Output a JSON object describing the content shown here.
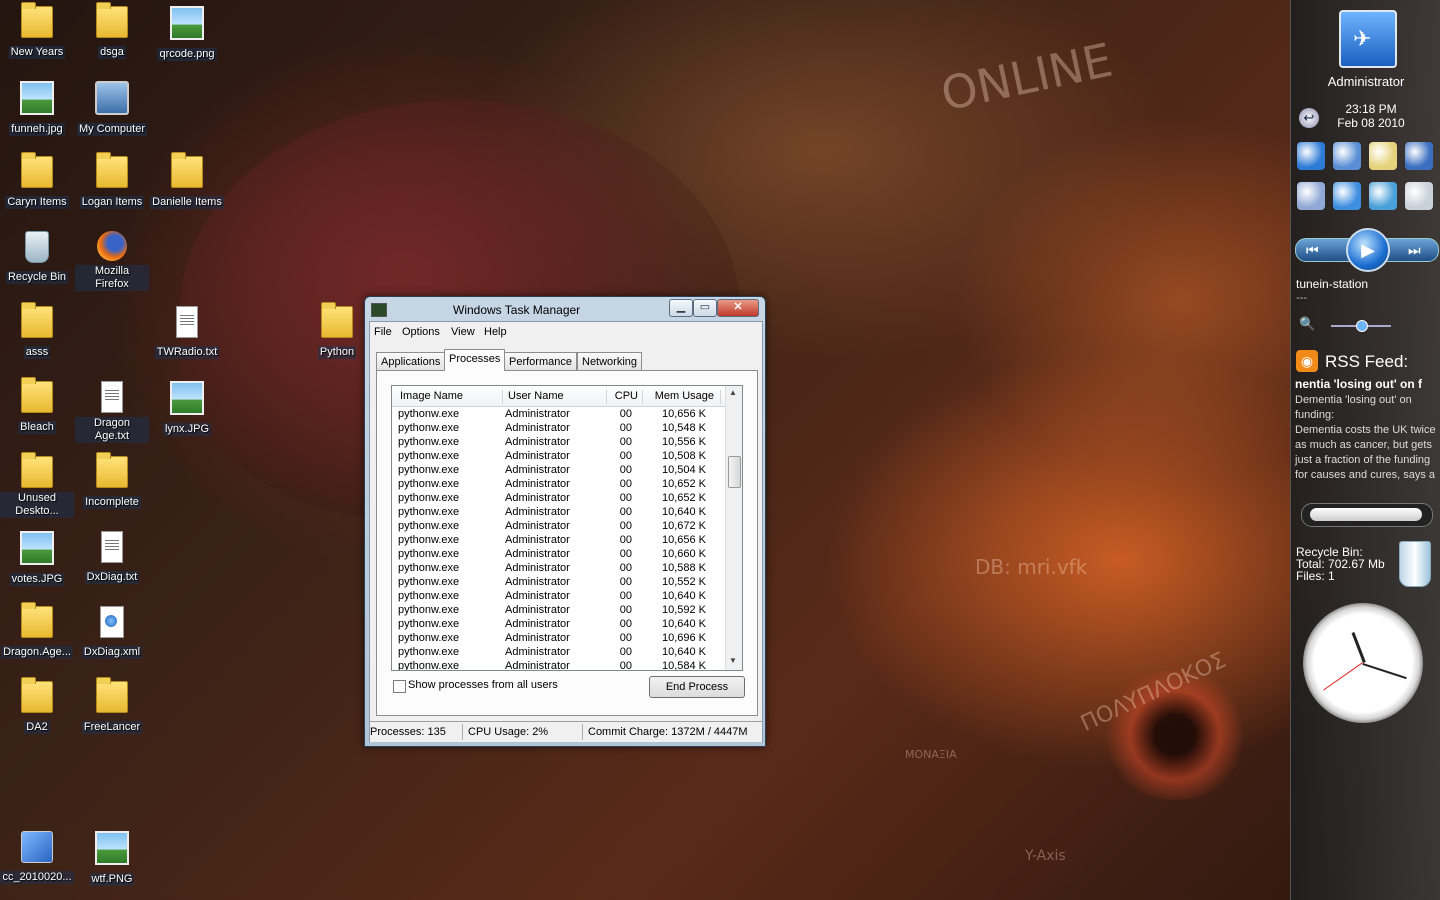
{
  "desktop": {
    "icons": [
      {
        "label": "New Years",
        "icon": "folder-icon",
        "type": "folder"
      },
      {
        "label": "dsga",
        "icon": "folder-icon",
        "type": "folder"
      },
      {
        "label": "qrcode.png",
        "icon": "image-file-icon",
        "type": "img"
      },
      {
        "label": "funneh.jpg",
        "icon": "image-file-icon",
        "type": "img"
      },
      {
        "label": "My Computer",
        "icon": "computer-icon",
        "type": "comp"
      },
      {
        "label": "Caryn Items",
        "icon": "folder-icon",
        "type": "folder"
      },
      {
        "label": "Logan Items",
        "icon": "folder-icon",
        "type": "folder"
      },
      {
        "label": "Danielle Items",
        "icon": "folder-icon",
        "type": "folder"
      },
      {
        "label": "Recycle Bin",
        "icon": "recycle-bin-icon",
        "type": "bin"
      },
      {
        "label": "Mozilla Firefox",
        "icon": "firefox-icon",
        "type": "fox"
      },
      {
        "label": "asss",
        "icon": "folder-icon",
        "type": "folder"
      },
      {
        "label": "TWRadio.txt",
        "icon": "text-file-icon",
        "type": "txt"
      },
      {
        "label": "Python",
        "icon": "folder-icon",
        "type": "folder"
      },
      {
        "label": "Bleach",
        "icon": "folder-icon",
        "type": "folder"
      },
      {
        "label": "Dragon Age.txt",
        "icon": "text-file-icon",
        "type": "txt"
      },
      {
        "label": "lynx.JPG",
        "icon": "image-file-icon",
        "type": "img"
      },
      {
        "label": "Unused Deskto...",
        "icon": "folder-icon",
        "type": "folder"
      },
      {
        "label": "Incomplete",
        "icon": "folder-icon",
        "type": "folder"
      },
      {
        "label": "votes.JPG",
        "icon": "image-file-icon",
        "type": "img"
      },
      {
        "label": "DxDiag.txt",
        "icon": "text-file-icon",
        "type": "txt"
      },
      {
        "label": "Dragon.Age...",
        "icon": "folder-icon",
        "type": "folder"
      },
      {
        "label": "DxDiag.xml",
        "icon": "xml-file-icon",
        "type": "xml"
      },
      {
        "label": "DA2",
        "icon": "folder-icon",
        "type": "folder"
      },
      {
        "label": "FreeLancer",
        "icon": "folder-icon",
        "type": "folder"
      },
      {
        "label": "cc_2010020...",
        "icon": "registry-file-icon",
        "type": "cc"
      },
      {
        "label": "wtf.PNG",
        "icon": "image-file-icon",
        "type": "img"
      }
    ],
    "wallpaper_text": [
      "ONLINE",
      "DB: mri.vfk",
      "Y-Axis",
      "MONAΞIA",
      "ΠΟΛΥΠΛΟΚΟΣ"
    ]
  },
  "sidebar": {
    "user_name": "Administrator",
    "time": "23:18 PM",
    "date": "Feb 08 2010",
    "quick_icons": [
      "globe-icon",
      "computer-icon",
      "document-icon",
      "network-icon",
      "mail-icon",
      "window-icon",
      "users-icon",
      "search-icon"
    ],
    "media": {
      "station": "tunein-station",
      "track": "---",
      "prev_icon": "previous-icon",
      "play_icon": "play-icon",
      "next_icon": "next-icon",
      "volume_level": 0.5
    },
    "rss": {
      "title": "RSS Feed:",
      "headline": "nentia 'losing out' on f",
      "body": "Dementia 'losing out' on funding:\nDementia costs the UK twice as much as cancer, but gets just a fraction of the funding for causes and cures, says a"
    },
    "recycle_bin": {
      "label": "Recycle Bin:",
      "total": "Total: 702.67 Mb",
      "files": "Files: 1"
    },
    "clock": {
      "hour": 23,
      "minute": 18
    }
  },
  "task_manager": {
    "title": "Windows Task Manager",
    "buttons": {
      "minimize": "▁",
      "maximize": "▭",
      "close": "✕"
    },
    "menu": [
      "File",
      "Options",
      "View",
      "Help"
    ],
    "tabs": [
      "Applications",
      "Processes",
      "Performance",
      "Networking"
    ],
    "selected_tab": "Processes",
    "columns": [
      "Image Name",
      "User Name",
      "CPU",
      "Mem Usage"
    ],
    "rows": [
      [
        "pythonw.exe",
        "Administrator",
        "00",
        "10,656 K"
      ],
      [
        "pythonw.exe",
        "Administrator",
        "00",
        "10,548 K"
      ],
      [
        "pythonw.exe",
        "Administrator",
        "00",
        "10,556 K"
      ],
      [
        "pythonw.exe",
        "Administrator",
        "00",
        "10,508 K"
      ],
      [
        "pythonw.exe",
        "Administrator",
        "00",
        "10,504 K"
      ],
      [
        "pythonw.exe",
        "Administrator",
        "00",
        "10,652 K"
      ],
      [
        "pythonw.exe",
        "Administrator",
        "00",
        "10,652 K"
      ],
      [
        "pythonw.exe",
        "Administrator",
        "00",
        "10,640 K"
      ],
      [
        "pythonw.exe",
        "Administrator",
        "00",
        "10,672 K"
      ],
      [
        "pythonw.exe",
        "Administrator",
        "00",
        "10,656 K"
      ],
      [
        "pythonw.exe",
        "Administrator",
        "00",
        "10,660 K"
      ],
      [
        "pythonw.exe",
        "Administrator",
        "00",
        "10,588 K"
      ],
      [
        "pythonw.exe",
        "Administrator",
        "00",
        "10,552 K"
      ],
      [
        "pythonw.exe",
        "Administrator",
        "00",
        "10,640 K"
      ],
      [
        "pythonw.exe",
        "Administrator",
        "00",
        "10,592 K"
      ],
      [
        "pythonw.exe",
        "Administrator",
        "00",
        "10,640 K"
      ],
      [
        "pythonw.exe",
        "Administrator",
        "00",
        "10,696 K"
      ],
      [
        "pythonw.exe",
        "Administrator",
        "00",
        "10,640 K"
      ],
      [
        "pythonw.exe",
        "Administrator",
        "00",
        "10,584 K"
      ]
    ],
    "show_all_label": "Show processes from all users",
    "show_all_checked": false,
    "end_process_label": "End Process",
    "status": {
      "processes": "Processes: 135",
      "cpu": "CPU Usage: 2%",
      "commit": "Commit Charge: 1372M / 4447M"
    }
  }
}
